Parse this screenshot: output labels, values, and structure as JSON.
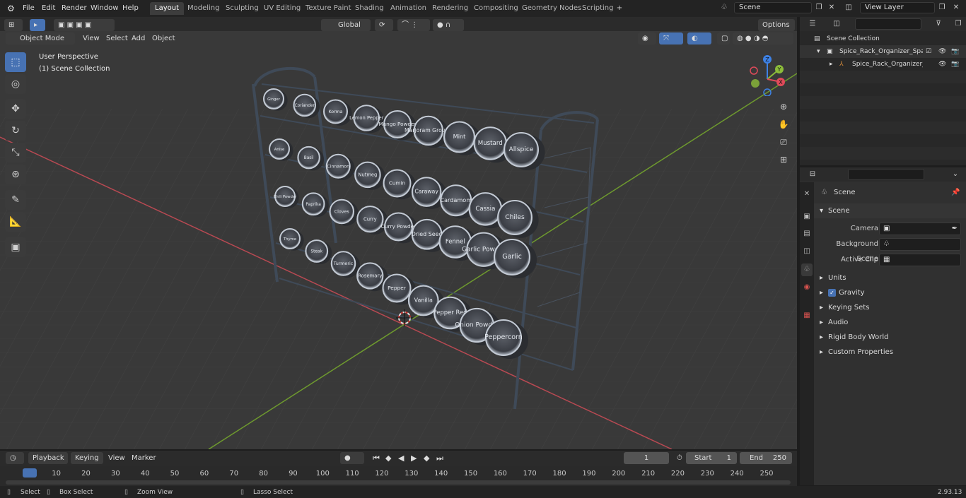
{
  "topbar": {
    "menus": [
      "File",
      "Edit",
      "Render",
      "Window",
      "Help"
    ],
    "workspaces": [
      "Layout",
      "Modeling",
      "Sculpting",
      "UV Editing",
      "Texture Paint",
      "Shading",
      "Animation",
      "Rendering",
      "Compositing",
      "Geometry Nodes",
      "Scripting"
    ],
    "active_workspace": "Layout",
    "scene_name": "Scene",
    "view_layer": "View Layer"
  },
  "viewport_header": {
    "mode": "Object Mode",
    "menus": [
      "View",
      "Select",
      "Add",
      "Object"
    ],
    "transform_orientation": "Global",
    "options_label": "Options"
  },
  "viewport": {
    "overlay_line1": "User Perspective",
    "overlay_line2": "(1) Scene Collection",
    "gizmo_axes": [
      "Z",
      "Y",
      "X"
    ],
    "rack_rows": [
      [
        "Ginger",
        "Coriander",
        "Korma",
        "Lemon Pepper",
        "Mango Powder",
        "Marjoram Ground",
        "Mint",
        "Mustard",
        "Allspice"
      ],
      [
        "Anise",
        "Basil",
        "Cinnamon",
        "Nutmeg",
        "Cumin",
        "Caraway",
        "Cardamom",
        "Cassia",
        "Chiles"
      ],
      [
        "Chili Powder",
        "Paprika",
        "Cloves",
        "Curry",
        "Curry Powder",
        "Dried Seed",
        "Fennel",
        "Garlic Powder",
        "Garlic"
      ],
      [
        "Thyme",
        "Steak",
        "Turmeric",
        "Rosemary",
        "Pepper",
        "Vanilla",
        "Pepper Red",
        "Onion Powder",
        "Peppercorn"
      ]
    ]
  },
  "outliner": {
    "root": "Scene Collection",
    "collection": "Spice_Rack_Organizer_Space",
    "object": "Spice_Rack_Organizer_Sp"
  },
  "properties": {
    "header": "Scene",
    "panel_title": "Scene",
    "fields": [
      {
        "label": "Camera"
      },
      {
        "label": "Background Scene"
      },
      {
        "label": "Active Clip"
      }
    ],
    "subpanels": [
      "Units",
      "Gravity",
      "Keying Sets",
      "Audio",
      "Rigid Body World",
      "Custom Properties"
    ]
  },
  "timeline": {
    "menus": [
      "Playback",
      "Keying",
      "View",
      "Marker"
    ],
    "current_frame": "1",
    "start_label": "Start",
    "start": "1",
    "end_label": "End",
    "end": "250",
    "ticks": [
      "1",
      "10",
      "20",
      "30",
      "40",
      "50",
      "60",
      "70",
      "80",
      "90",
      "100",
      "110",
      "120",
      "130",
      "140",
      "150",
      "160",
      "170",
      "180",
      "190",
      "200",
      "210",
      "220",
      "230",
      "240",
      "250"
    ]
  },
  "statusbar": {
    "items": [
      "Select",
      "Box Select",
      "Zoom View",
      "Lasso Select"
    ],
    "version": "2.93.13"
  },
  "colors": {
    "accent": "#4772b3",
    "x_axis": "#e04a5a",
    "y_axis": "#8cbc3a",
    "z_axis": "#3e82e6",
    "rack_metal": "#3f4a58"
  }
}
